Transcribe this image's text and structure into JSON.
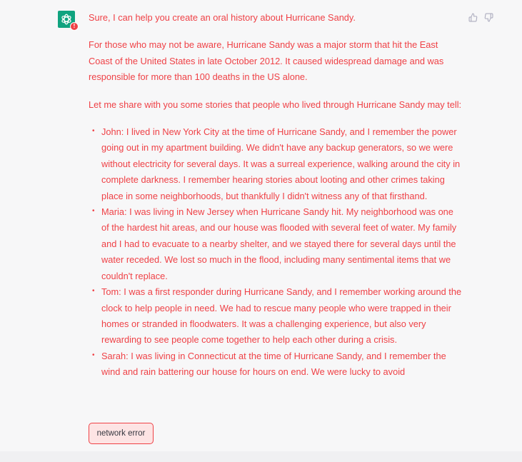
{
  "message": {
    "intro": "Sure, I can help you create an oral history about Hurricane Sandy.",
    "paragraph_1": "For those who may not be aware, Hurricane Sandy was a major storm that hit the East Coast of the United States in late October 2012. It caused widespread damage and was responsible for more than 100 deaths in the US alone.",
    "paragraph_2": "Let me share with you some stories that people who lived through Hurricane Sandy may tell:",
    "stories": [
      "John: I lived in New York City at the time of Hurricane Sandy, and I remember the power going out in my apartment building. We didn't have any backup generators, so we were without electricity for several days. It was a surreal experience, walking around the city in complete darkness. I remember hearing stories about looting and other crimes taking place in some neighborhoods, but thankfully I didn't witness any of that firsthand.",
      "Maria: I was living in New Jersey when Hurricane Sandy hit. My neighborhood was one of the hardest hit areas, and our house was flooded with several feet of water. My family and I had to evacuate to a nearby shelter, and we stayed there for several days until the water receded. We lost so much in the flood, including many sentimental items that we couldn't replace.",
      "Tom: I was a first responder during Hurricane Sandy, and I remember working around the clock to help people in need. We had to rescue many people who were trapped in their homes or stranded in floodwaters. It was a challenging experience, but also very rewarding to see people come together to help each other during a crisis.",
      "Sarah: I was living in Connecticut at the time of Hurricane Sandy, and I remember the wind and rain battering our house for hours on end. We were lucky to avoid"
    ]
  },
  "avatar": {
    "icon": "assistant-logo-icon",
    "badge": "!"
  },
  "feedback": {
    "like_icon": "thumbs-up-icon",
    "dislike_icon": "thumbs-down-icon"
  },
  "error": {
    "label": "network error"
  },
  "colors": {
    "text": "#ef4146",
    "avatar_bg": "#10a37f",
    "error_bg": "#fde4e4",
    "error_border": "#ef4146",
    "background": "#f7f7f8"
  }
}
